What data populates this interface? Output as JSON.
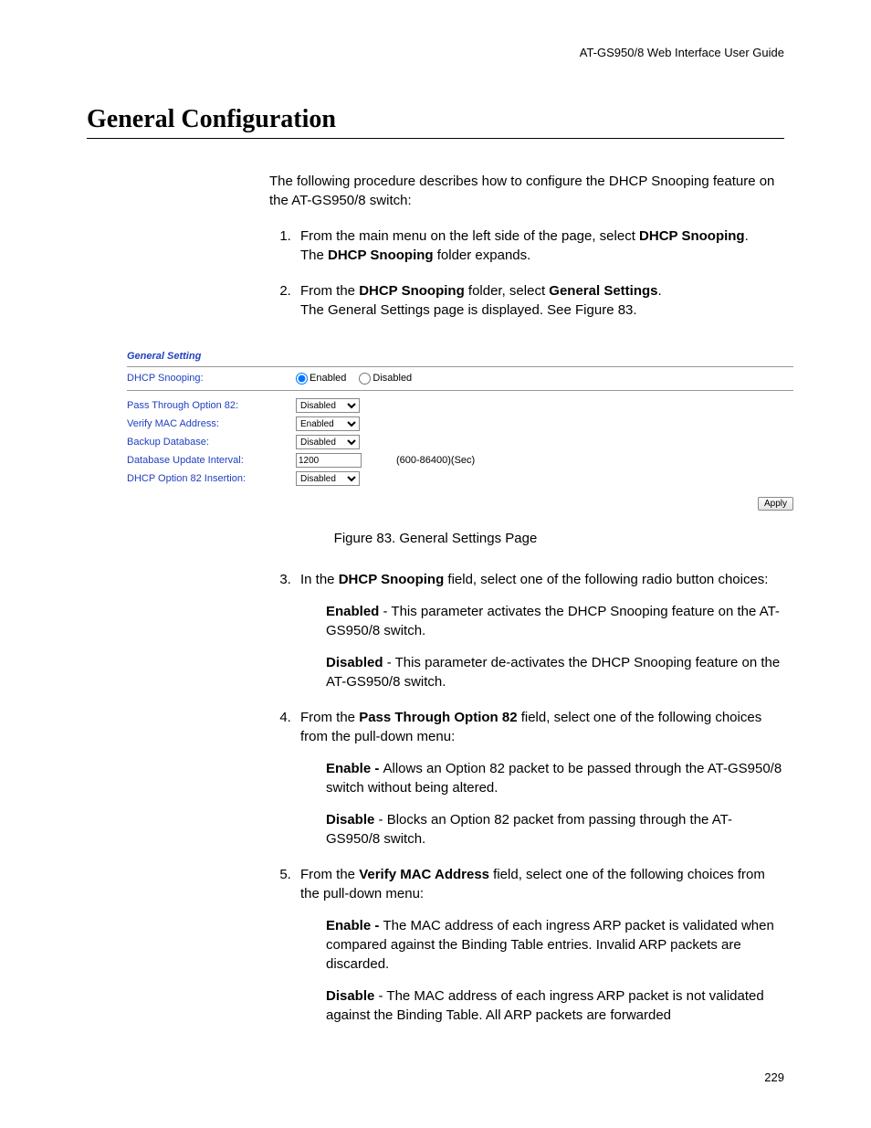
{
  "header": "AT-GS950/8  Web Interface User Guide",
  "section_title": "General Configuration",
  "intro": "The following procedure describes how to configure the DHCP Snooping feature on the AT-GS950/8 switch:",
  "step1": {
    "pre": "From the main menu on the left side of the page, select ",
    "bold1": "DHCP Snooping",
    "post1": ".",
    "line2a": "The ",
    "line2b": "DHCP Snooping",
    "line2c": " folder expands."
  },
  "step2": {
    "pre": "From the ",
    "bold1": "DHCP Snooping",
    "mid": " folder, select ",
    "bold2": "General Settings",
    "post": ".",
    "line2": "The General Settings page is displayed. See Figure 83."
  },
  "figure": {
    "panel_title": "General Setting",
    "rows": {
      "snooping": {
        "label": "DHCP Snooping:",
        "enabled": "Enabled",
        "disabled": "Disabled"
      },
      "passthrough": {
        "label": "Pass Through Option 82:",
        "value": "Disabled"
      },
      "verifymac": {
        "label": "Verify MAC Address:",
        "value": "Enabled"
      },
      "backupdb": {
        "label": "Backup Database:",
        "value": "Disabled"
      },
      "dbinterval": {
        "label": "Database Update Interval:",
        "value": "1200",
        "range": "(600-86400)(Sec)"
      },
      "opt82ins": {
        "label": "DHCP Option 82 Insertion:",
        "value": "Disabled"
      }
    },
    "apply": "Apply",
    "caption": "Figure 83. General Settings Page"
  },
  "step3": {
    "pre": "In the ",
    "bold1": "DHCP Snooping",
    "post": " field, select one of the following radio button choices:",
    "enabled_b": "Enabled",
    "enabled_t": " - This parameter activates the DHCP Snooping feature on the AT-GS950/8 switch.",
    "disabled_b": "Disabled",
    "disabled_t": " - This parameter de-activates the DHCP Snooping feature on the AT-GS950/8 switch."
  },
  "step4": {
    "pre": "From the ",
    "bold1": "Pass Through Option 82",
    "post": " field, select one of the following choices from the pull-down menu:",
    "enable_b": "Enable - ",
    "enable_t": "Allows an Option 82 packet to be passed through the AT-GS950/8 switch without being altered.",
    "disable_b": "Disable",
    "disable_t": " - Blocks an Option 82 packet from passing through the AT-GS950/8 switch."
  },
  "step5": {
    "pre": "From the ",
    "bold1": "Verify MAC Address",
    "post": " field, select one of the following choices from the pull-down menu:",
    "enable_b": "Enable - ",
    "enable_t": "The MAC address of each ingress ARP packet is validated when compared against the Binding Table entries. Invalid ARP packets are discarded.",
    "disable_b": "Disable",
    "disable_t": " - The MAC address of each ingress ARP packet is not validated against the Binding Table. All ARP packets are forwarded"
  },
  "page_number": "229"
}
